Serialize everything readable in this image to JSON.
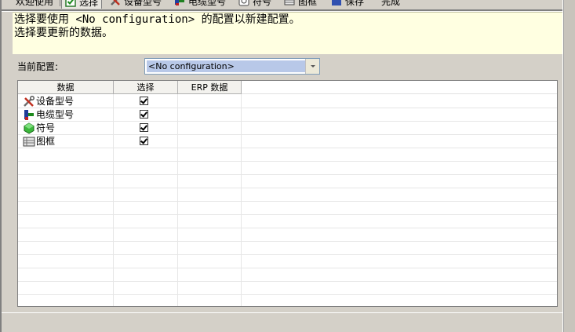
{
  "tabs": [
    {
      "label": "欢迎使用",
      "icon": "none"
    },
    {
      "label": "选择",
      "icon": "checkbox-icon",
      "active": true
    },
    {
      "label": "设备型号",
      "icon": "tools-icon"
    },
    {
      "label": "电缆型号",
      "icon": "cable-icon"
    },
    {
      "label": "符号",
      "icon": "symbol-icon"
    },
    {
      "label": "图框",
      "icon": "frame-icon"
    },
    {
      "label": "保存",
      "icon": "save-icon"
    },
    {
      "label": "完成",
      "icon": "none"
    }
  ],
  "info": {
    "line1": "选择要使用 <No configuration> 的配置以新建配置。",
    "line2": "选择要更新的数据。"
  },
  "config": {
    "label": "当前配置:",
    "selected": "<No configuration>"
  },
  "grid": {
    "columns": [
      "数据",
      "选择",
      "ERP 数据"
    ],
    "rows": [
      {
        "name": "设备型号",
        "icon": "tools-icon",
        "checked": true
      },
      {
        "name": "电缆型号",
        "icon": "cable-icon",
        "checked": true
      },
      {
        "name": "符号",
        "icon": "symbol-icon",
        "checked": true
      },
      {
        "name": "图框",
        "icon": "frame-icon",
        "checked": true
      }
    ]
  },
  "colors": {
    "info_bg": "#ffffe1",
    "window_bg": "#d4d0c8",
    "combo_highlight": "#b8c8e8"
  }
}
